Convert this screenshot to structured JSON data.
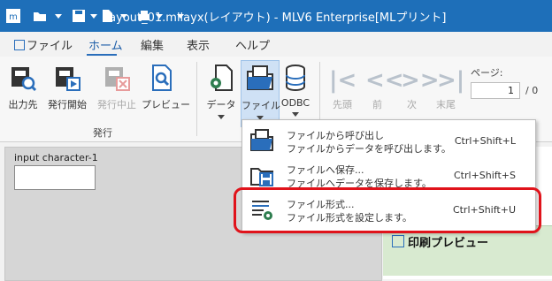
{
  "titlebar": {
    "title": "layout_01.mllayx(レイアウト) - MLV6 Enterprise[MLプリント]",
    "bg_color": "#1e6fb9"
  },
  "menu": {
    "tabs": [
      {
        "label": "ファイル"
      },
      {
        "label": "ホーム"
      },
      {
        "label": "編集"
      },
      {
        "label": "表示"
      },
      {
        "label": "ヘルプ"
      }
    ],
    "active": "ホーム"
  },
  "ribbon": {
    "issue_group": {
      "label": "発行",
      "buttons": [
        {
          "label": "出力先",
          "icon": "output-destination-icon"
        },
        {
          "label": "発行開始",
          "icon": "start-issue-icon"
        },
        {
          "label": "発行中止",
          "icon": "stop-issue-icon",
          "disabled": true
        },
        {
          "label": "プレビュー",
          "icon": "preview-icon"
        }
      ]
    },
    "data_group": {
      "buttons": [
        {
          "label": "データ",
          "icon": "data-gear-icon"
        },
        {
          "label": "ファイル",
          "icon": "file-folder-icon",
          "active": true
        },
        {
          "label": "ODBC",
          "icon": "database-icon"
        }
      ]
    },
    "nav": {
      "first": "先頭",
      "prev": "前",
      "next": "次",
      "last": "末尾",
      "page_label": "ページ:",
      "page_value": "1",
      "page_total": "/ 0"
    }
  },
  "workspace": {
    "field_label": "input character-1",
    "preview_title": "印刷プレビュー"
  },
  "dropdown": {
    "items": [
      {
        "title": "ファイルから呼び出し",
        "desc": "ファイルからデータを呼び出します。",
        "shortcut": "Ctrl+Shift+L",
        "icon": "open-folder-icon"
      },
      {
        "title": "ファイルへ保存...",
        "desc": "ファイルへデータを保存します。",
        "shortcut": "Ctrl+Shift+S",
        "icon": "save-icon"
      },
      {
        "title": "ファイル形式...",
        "desc": "ファイル形式を設定します。",
        "shortcut": "Ctrl+Shift+U",
        "icon": "file-format-icon"
      }
    ],
    "highlight_color": "#e0131b"
  }
}
